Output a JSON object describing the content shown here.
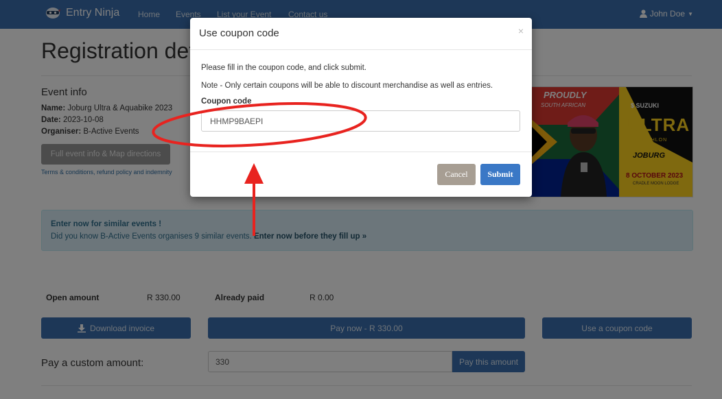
{
  "navbar": {
    "brand": "Entry Ninja",
    "links": [
      "Home",
      "Events",
      "List your Event",
      "Contact us"
    ],
    "user": "John Doe"
  },
  "page": {
    "title": "Registration det",
    "event_heading": "Event info",
    "name_label": "Name:",
    "name_value": " Joburg Ultra & Aquabike 2023",
    "date_label": "Date:",
    "date_value": " 2023-10-08",
    "organiser_label": "Organiser:",
    "organiser_value": " B-Active Events",
    "full_info_button": "Full event info & Map directions",
    "terms_link": "Terms & conditions, refund policy and indemnity",
    "banner": {
      "proudly": "PROUDLY",
      "south_african": "SOUTH AFRICAN",
      "brand": "$ SUZUKI",
      "ultra": "ULTRA",
      "triathlon": "TRIATHLON",
      "joburg": "JOBURG",
      "date": "8 OCTOBER 2023",
      "venue": "CRADLE MOON LODGE"
    },
    "alert": {
      "title": "Enter now for similar events !",
      "text": "Did you know B-Active Events organises 9 similar events.",
      "link": "Enter now before they fill up »"
    },
    "open_amount_label": "Open amount",
    "open_amount_value": "R 330.00",
    "already_paid_label": "Already paid",
    "already_paid_value": "R 0.00",
    "download_invoice": "Download invoice",
    "pay_now": "Pay now - R 330.00",
    "use_coupon": "Use a coupon code",
    "custom_amount_label": "Pay a custom amount:",
    "custom_amount_value": "330",
    "pay_this_amount": "Pay this amount"
  },
  "modal": {
    "title": "Use coupon code",
    "close": "×",
    "instruction": "Please fill in the coupon code, and click submit.",
    "note": "Note - Only certain coupons will be able to discount merchandise as well as entries.",
    "coupon_label": "Coupon code",
    "coupon_value": "HHMP9BAEPI",
    "cancel": "Cancel",
    "submit": "Submit"
  },
  "colors": {
    "navbar": "#3a6fae",
    "primary_button": "#3a6fae",
    "submit": "#3a78c6",
    "cancel": "#a79e93",
    "annotation": "#e8231f",
    "alert_bg": "#d9edf7"
  }
}
